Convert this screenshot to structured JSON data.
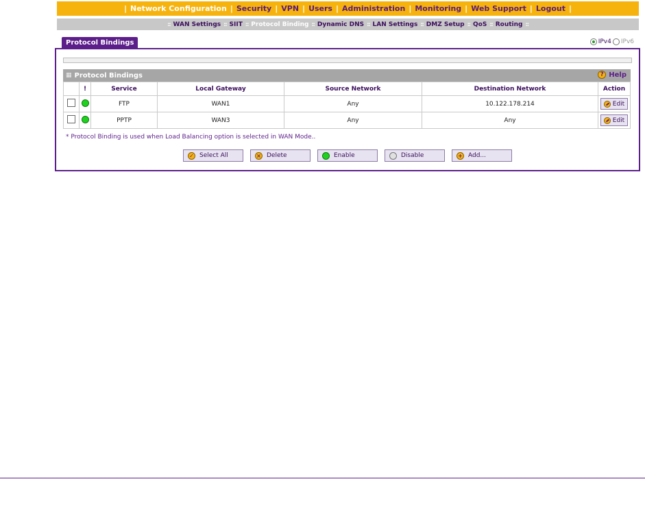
{
  "topnav": {
    "items": [
      "Network Configuration",
      "Security",
      "VPN",
      "Users",
      "Administration",
      "Monitoring",
      "Web Support",
      "Logout"
    ]
  },
  "subnav": {
    "items": [
      "WAN Settings",
      "SIIT",
      "Protocol Binding",
      "Dynamic DNS",
      "LAN Settings",
      "DMZ Setup",
      "QoS",
      "Routing"
    ],
    "active": "Protocol Binding"
  },
  "tab": {
    "label": "Protocol Bindings"
  },
  "ip_version": {
    "ipv4": "IPv4",
    "ipv6": "IPv6",
    "selected": "IPv4"
  },
  "section": {
    "title": "Protocol Bindings",
    "help": "Help",
    "columns": [
      "",
      "!",
      "Service",
      "Local Gateway",
      "Source Network",
      "Destination Network",
      "Action"
    ],
    "rows": [
      {
        "service": "FTP",
        "gateway": "WAN1",
        "source": "Any",
        "destination": "10.122.178.214",
        "action": "Edit"
      },
      {
        "service": "PPTP",
        "gateway": "WAN3",
        "source": "Any",
        "destination": "Any",
        "action": "Edit"
      }
    ],
    "note": "* Protocol Binding is used when Load Balancing option is selected in WAN Mode.."
  },
  "buttons": {
    "select_all": "Select All",
    "delete": "Delete",
    "enable": "Enable",
    "disable": "Disable",
    "add": "Add..."
  },
  "colors": {
    "accent": "#5c1e8a",
    "nav": "#f7b30d",
    "status_on": "#1fd21f"
  }
}
